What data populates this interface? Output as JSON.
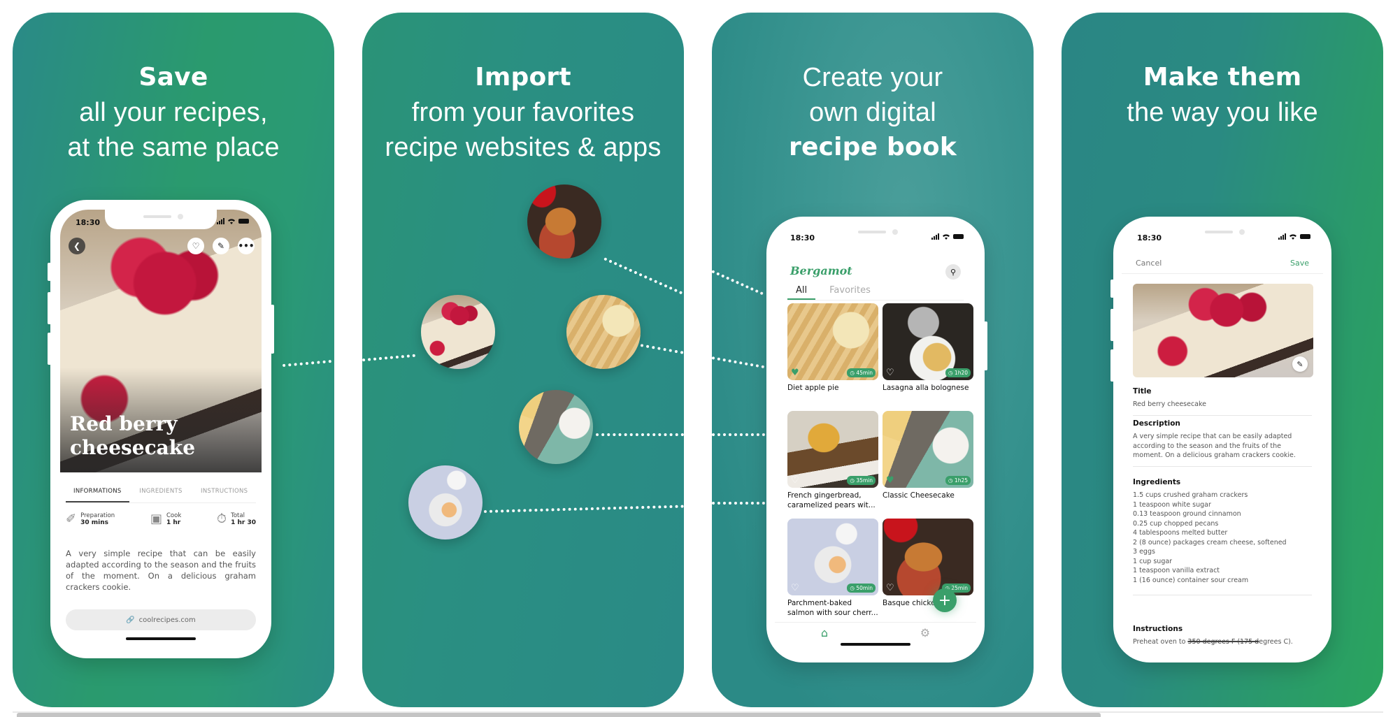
{
  "panels": [
    {
      "headline": {
        "bold": "Save",
        "line2": "all your recipes,",
        "line3": "at the same place"
      }
    },
    {
      "headline": {
        "bold": "Import",
        "line2": "from your favorites",
        "line3": "recipe websites & apps"
      }
    },
    {
      "headline": {
        "line1": "Create your",
        "line2": "own digital",
        "bold": "recipe book"
      }
    },
    {
      "headline": {
        "bold": "Make them",
        "line2": "the way you like"
      }
    }
  ],
  "status_bar": {
    "time": "18:30"
  },
  "recipe_detail": {
    "title_line1": "Red berry",
    "title_line2": "cheesecake",
    "icons": {
      "back": "chevron-left-icon",
      "favorite": "heart-icon",
      "edit": "pencil-icon",
      "more": "more-icon"
    },
    "tabs": [
      "INFORMATIONS",
      "INGREDIENTS",
      "INSTRUCTIONS"
    ],
    "active_tab": "INFORMATIONS",
    "times": [
      {
        "label": "Preparation",
        "value": "30 mins",
        "icon": "whisk-icon"
      },
      {
        "label": "Cook",
        "value": "1 hr",
        "icon": "pot-icon"
      },
      {
        "label": "Total",
        "value": "1 hr 30",
        "icon": "stopwatch-icon"
      }
    ],
    "description": "A very simple recipe that can be easily adapted according to the season and the fruits of the moment. On a delicious graham crackers cookie.",
    "source_link": "coolrecipes.com"
  },
  "import_sources": [
    "Basque chicken",
    "Red berry cheesecake",
    "Diet apple pie",
    "Classic Cheesecake",
    "Parchment-baked salmon"
  ],
  "recipe_book": {
    "brand": "Bergamot",
    "tabs": [
      "All",
      "Favorites"
    ],
    "active_tab": "All",
    "recipes": [
      {
        "name": "Diet apple pie",
        "time": "45min",
        "favorite": true
      },
      {
        "name": "Lasagna alla bolognese",
        "time": "1h20",
        "favorite": false
      },
      {
        "name": "French gingerbread, caramelized pears wit...",
        "time": "35min",
        "favorite": false
      },
      {
        "name": "Classic Cheesecake",
        "time": "1h25",
        "favorite": true
      },
      {
        "name": "Parchment-baked salmon with sour cherr...",
        "time": "50min",
        "favorite": false
      },
      {
        "name": "Basque chicken",
        "time": "25min",
        "favorite": false
      }
    ],
    "fab_label": "+",
    "nav": [
      "home",
      "settings"
    ]
  },
  "edit_recipe": {
    "cancel": "Cancel",
    "save": "Save",
    "fields": {
      "title_label": "Title",
      "title_value": "Red berry cheesecake",
      "description_label": "Description",
      "description_value": "A very simple recipe that can be easily adapted according to the season and the fruits of the moment. On a delicious graham crackers cookie.",
      "ingredients_label": "Ingredients",
      "ingredients": [
        "1.5 cups crushed graham crackers",
        "1 teaspoon white sugar",
        "0.13 teaspoon ground cinnamon",
        "0.25 cup chopped pecans",
        "4 tablespoons melted butter",
        "2 (8 ounce) packages cream cheese, softened",
        "3 eggs",
        "1 cup sugar",
        "1 teaspoon vanilla extract",
        "1 (16 ounce) container sour cream"
      ],
      "instructions_label": "Instructions",
      "instructions_pre": "Preheat oven to ",
      "instructions_struck": "350 degrees F (175 d",
      "instructions_post": "egrees C)."
    }
  },
  "colors": {
    "accent": "#3a9f6a",
    "panel_teal": "#2a8a86",
    "panel_green": "#2aa45e"
  }
}
